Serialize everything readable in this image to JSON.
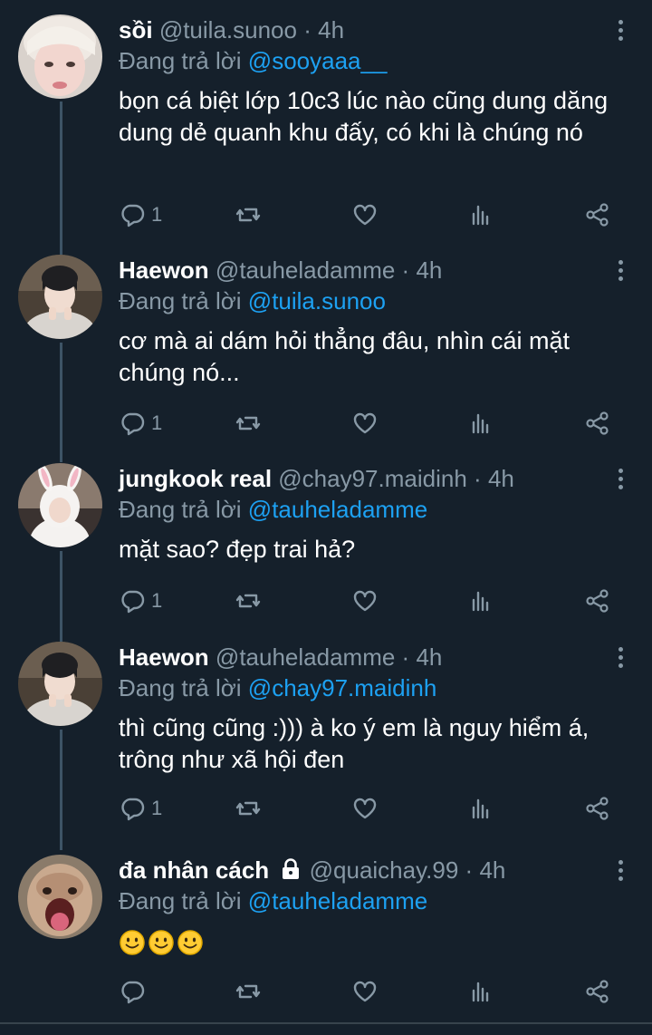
{
  "tweets": [
    {
      "name": "sồi",
      "handle": "@tuila.sunoo",
      "dot": "·",
      "time": "4h",
      "reply_prefix": "Đang trả lời",
      "reply_to": "@sooyaaa__",
      "text": "bọn cá biệt lớp 10c3 lúc nào cũng dung dăng dung dẻ quanh khu đấy, có khi là chúng nó",
      "reply_count": "1",
      "locked": false
    },
    {
      "name": "Haewon",
      "handle": "@tauheladamme",
      "dot": "·",
      "time": "4h",
      "reply_prefix": "Đang trả lời",
      "reply_to": "@tuila.sunoo",
      "text": "cơ mà ai dám hỏi thẳng đâu, nhìn cái mặt chúng nó...",
      "reply_count": "1",
      "locked": false
    },
    {
      "name": "jungkook real",
      "handle": "@chay97.maidinh",
      "dot": "·",
      "time": "4h",
      "reply_prefix": "Đang trả lời",
      "reply_to": "@tauheladamme",
      "text": "mặt sao? đẹp trai hả?",
      "reply_count": "1",
      "locked": false
    },
    {
      "name": "Haewon",
      "handle": "@tauheladamme",
      "dot": "·",
      "time": "4h",
      "reply_prefix": "Đang trả lời",
      "reply_to": "@chay97.maidinh",
      "text": "thì cũng cũng :))) à ko ý em là nguy hiểm á, trông như xã hội đen",
      "reply_count": "1",
      "locked": false
    },
    {
      "name": "đa nhân cách",
      "handle": "@quaichay.99",
      "dot": "·",
      "time": "4h",
      "reply_prefix": "Đang trả lời",
      "reply_to": "@tauheladamme",
      "text": "",
      "emoji": [
        "smiling-face-emoji",
        "smiling-face-emoji",
        "smiling-face-emoji"
      ],
      "reply_count": "",
      "locked": true
    }
  ],
  "icons": {
    "reply": "reply-icon",
    "retweet": "retweet-icon",
    "like": "heart-icon",
    "views": "views-icon",
    "share": "share-icon",
    "more": "more-vertical-icon",
    "lock": "lock-icon"
  },
  "colors": {
    "background": "#15202b",
    "text": "#ffffff",
    "secondary": "#8899a6",
    "mention": "#1da1f2",
    "thread_line": "#3d5466"
  }
}
